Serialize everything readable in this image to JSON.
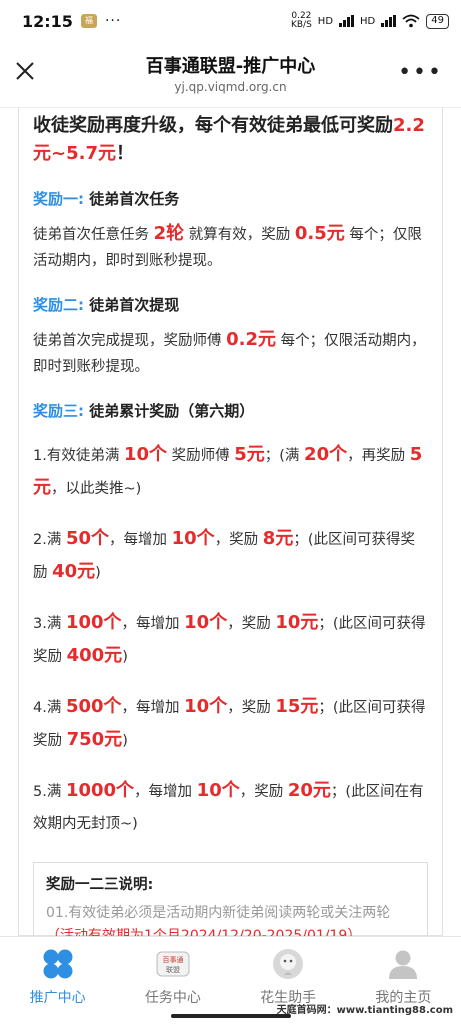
{
  "status": {
    "time": "12:15",
    "badge": "福",
    "speed_top": "0.22",
    "speed_bottom": "KB/S",
    "hd1": "HD",
    "hd2": "HD",
    "battery": "49"
  },
  "header": {
    "title": "百事通联盟-推广中心",
    "url": "yj.qp.viqmd.org.cn"
  },
  "headline": {
    "text": "收徒奖励再度升级，每个有效徒弟最低可奖励",
    "range": "2.2元~5.7元",
    "end": "！"
  },
  "reward1": {
    "label": "奖励一:",
    "title": "徒弟首次任务",
    "p1": "徒弟首次任意任务",
    "v1": "2轮",
    "p2": "就算有效，奖励",
    "v2": "0.5元",
    "p3": "每个；仅限活动期内，即时到账秒提现。"
  },
  "reward2": {
    "label": "奖励二:",
    "title": "徒弟首次提现",
    "p1": "徒弟首次完成提现，奖励师傅",
    "v1": "0.2元",
    "p2": "每个；仅限活动期内，即时到账秒提现。"
  },
  "reward3": {
    "label": "奖励三:",
    "title": "徒弟累计奖励（第六期）"
  },
  "tiers": [
    {
      "a": "1.有效徒弟满",
      "b": "10个",
      "c": "奖励师傅",
      "d": "5元",
      "e": "；(满",
      "f": "20个",
      "g": "，再奖励",
      "h": "5元",
      "i": "，以此类推~)"
    },
    {
      "a": "2.满",
      "b": "50个",
      "c": "，每增加",
      "d": "10个",
      "e": "，奖励",
      "f": "8元",
      "g": "；(此区间可获得奖励",
      "h": "40元",
      "i": ")"
    },
    {
      "a": "3.满",
      "b": "100个",
      "c": "，每增加",
      "d": "10个",
      "e": "，奖励",
      "f": "10元",
      "g": "；(此区间可获得奖励",
      "h": "400元",
      "i": ")"
    },
    {
      "a": "4.满",
      "b": "500个",
      "c": "，每增加",
      "d": "10个",
      "e": "，奖励",
      "f": "15元",
      "g": "；(此区间可获得奖励",
      "h": "750元",
      "i": ")"
    },
    {
      "a": "5.满",
      "b": "1000个",
      "c": "，每增加",
      "d": "10个",
      "e": "，奖励",
      "f": "20元",
      "g": "；(此区间在有效期内无封顶~)",
      "h": "",
      "i": ""
    }
  ],
  "note": {
    "title": "奖励一二三说明:",
    "text": "01.有效徒弟必须是活动期内新徒弟阅读两轮或关注两轮",
    "red": "（活动有效期为1个月2024/12/20-2025/01/19）"
  },
  "tabs": [
    {
      "label": "推广中心",
      "icon": "four-petal-icon"
    },
    {
      "label": "任务中心",
      "icon": "union-logo-icon",
      "logo_top": "百事通",
      "logo_bottom": "联盟"
    },
    {
      "label": "花生助手",
      "icon": "assistant-avatar-icon"
    },
    {
      "label": "我的主页",
      "icon": "user-silhouette-icon"
    }
  ],
  "watermark": "天庭首码网：www.tianting88.com",
  "colors": {
    "accent": "#2f8fe3",
    "red": "#e52b2b"
  }
}
